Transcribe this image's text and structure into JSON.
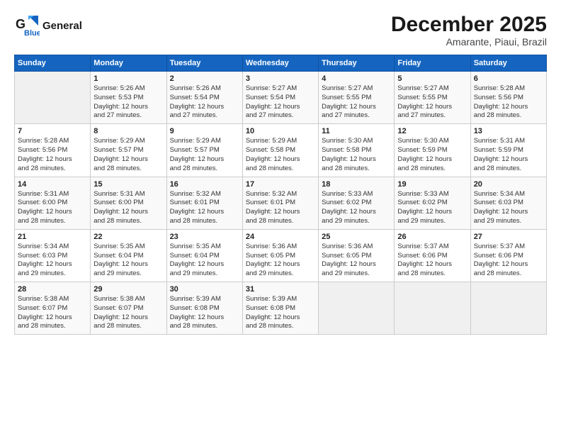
{
  "header": {
    "logo_line1": "General",
    "logo_line2": "Blue",
    "title": "December 2025",
    "subtitle": "Amarante, Piaui, Brazil"
  },
  "columns": [
    "Sunday",
    "Monday",
    "Tuesday",
    "Wednesday",
    "Thursday",
    "Friday",
    "Saturday"
  ],
  "weeks": [
    [
      {
        "day": "",
        "sunrise": "",
        "sunset": "",
        "daylight": ""
      },
      {
        "day": "1",
        "sunrise": "Sunrise: 5:26 AM",
        "sunset": "Sunset: 5:53 PM",
        "daylight": "Daylight: 12 hours and 27 minutes."
      },
      {
        "day": "2",
        "sunrise": "Sunrise: 5:26 AM",
        "sunset": "Sunset: 5:54 PM",
        "daylight": "Daylight: 12 hours and 27 minutes."
      },
      {
        "day": "3",
        "sunrise": "Sunrise: 5:27 AM",
        "sunset": "Sunset: 5:54 PM",
        "daylight": "Daylight: 12 hours and 27 minutes."
      },
      {
        "day": "4",
        "sunrise": "Sunrise: 5:27 AM",
        "sunset": "Sunset: 5:55 PM",
        "daylight": "Daylight: 12 hours and 27 minutes."
      },
      {
        "day": "5",
        "sunrise": "Sunrise: 5:27 AM",
        "sunset": "Sunset: 5:55 PM",
        "daylight": "Daylight: 12 hours and 27 minutes."
      },
      {
        "day": "6",
        "sunrise": "Sunrise: 5:28 AM",
        "sunset": "Sunset: 5:56 PM",
        "daylight": "Daylight: 12 hours and 28 minutes."
      }
    ],
    [
      {
        "day": "7",
        "sunrise": "Sunrise: 5:28 AM",
        "sunset": "Sunset: 5:56 PM",
        "daylight": "Daylight: 12 hours and 28 minutes."
      },
      {
        "day": "8",
        "sunrise": "Sunrise: 5:29 AM",
        "sunset": "Sunset: 5:57 PM",
        "daylight": "Daylight: 12 hours and 28 minutes."
      },
      {
        "day": "9",
        "sunrise": "Sunrise: 5:29 AM",
        "sunset": "Sunset: 5:57 PM",
        "daylight": "Daylight: 12 hours and 28 minutes."
      },
      {
        "day": "10",
        "sunrise": "Sunrise: 5:29 AM",
        "sunset": "Sunset: 5:58 PM",
        "daylight": "Daylight: 12 hours and 28 minutes."
      },
      {
        "day": "11",
        "sunrise": "Sunrise: 5:30 AM",
        "sunset": "Sunset: 5:58 PM",
        "daylight": "Daylight: 12 hours and 28 minutes."
      },
      {
        "day": "12",
        "sunrise": "Sunrise: 5:30 AM",
        "sunset": "Sunset: 5:59 PM",
        "daylight": "Daylight: 12 hours and 28 minutes."
      },
      {
        "day": "13",
        "sunrise": "Sunrise: 5:31 AM",
        "sunset": "Sunset: 5:59 PM",
        "daylight": "Daylight: 12 hours and 28 minutes."
      }
    ],
    [
      {
        "day": "14",
        "sunrise": "Sunrise: 5:31 AM",
        "sunset": "Sunset: 6:00 PM",
        "daylight": "Daylight: 12 hours and 28 minutes."
      },
      {
        "day": "15",
        "sunrise": "Sunrise: 5:31 AM",
        "sunset": "Sunset: 6:00 PM",
        "daylight": "Daylight: 12 hours and 28 minutes."
      },
      {
        "day": "16",
        "sunrise": "Sunrise: 5:32 AM",
        "sunset": "Sunset: 6:01 PM",
        "daylight": "Daylight: 12 hours and 28 minutes."
      },
      {
        "day": "17",
        "sunrise": "Sunrise: 5:32 AM",
        "sunset": "Sunset: 6:01 PM",
        "daylight": "Daylight: 12 hours and 28 minutes."
      },
      {
        "day": "18",
        "sunrise": "Sunrise: 5:33 AM",
        "sunset": "Sunset: 6:02 PM",
        "daylight": "Daylight: 12 hours and 29 minutes."
      },
      {
        "day": "19",
        "sunrise": "Sunrise: 5:33 AM",
        "sunset": "Sunset: 6:02 PM",
        "daylight": "Daylight: 12 hours and 29 minutes."
      },
      {
        "day": "20",
        "sunrise": "Sunrise: 5:34 AM",
        "sunset": "Sunset: 6:03 PM",
        "daylight": "Daylight: 12 hours and 29 minutes."
      }
    ],
    [
      {
        "day": "21",
        "sunrise": "Sunrise: 5:34 AM",
        "sunset": "Sunset: 6:03 PM",
        "daylight": "Daylight: 12 hours and 29 minutes."
      },
      {
        "day": "22",
        "sunrise": "Sunrise: 5:35 AM",
        "sunset": "Sunset: 6:04 PM",
        "daylight": "Daylight: 12 hours and 29 minutes."
      },
      {
        "day": "23",
        "sunrise": "Sunrise: 5:35 AM",
        "sunset": "Sunset: 6:04 PM",
        "daylight": "Daylight: 12 hours and 29 minutes."
      },
      {
        "day": "24",
        "sunrise": "Sunrise: 5:36 AM",
        "sunset": "Sunset: 6:05 PM",
        "daylight": "Daylight: 12 hours and 29 minutes."
      },
      {
        "day": "25",
        "sunrise": "Sunrise: 5:36 AM",
        "sunset": "Sunset: 6:05 PM",
        "daylight": "Daylight: 12 hours and 29 minutes."
      },
      {
        "day": "26",
        "sunrise": "Sunrise: 5:37 AM",
        "sunset": "Sunset: 6:06 PM",
        "daylight": "Daylight: 12 hours and 28 minutes."
      },
      {
        "day": "27",
        "sunrise": "Sunrise: 5:37 AM",
        "sunset": "Sunset: 6:06 PM",
        "daylight": "Daylight: 12 hours and 28 minutes."
      }
    ],
    [
      {
        "day": "28",
        "sunrise": "Sunrise: 5:38 AM",
        "sunset": "Sunset: 6:07 PM",
        "daylight": "Daylight: 12 hours and 28 minutes."
      },
      {
        "day": "29",
        "sunrise": "Sunrise: 5:38 AM",
        "sunset": "Sunset: 6:07 PM",
        "daylight": "Daylight: 12 hours and 28 minutes."
      },
      {
        "day": "30",
        "sunrise": "Sunrise: 5:39 AM",
        "sunset": "Sunset: 6:08 PM",
        "daylight": "Daylight: 12 hours and 28 minutes."
      },
      {
        "day": "31",
        "sunrise": "Sunrise: 5:39 AM",
        "sunset": "Sunset: 6:08 PM",
        "daylight": "Daylight: 12 hours and 28 minutes."
      },
      {
        "day": "",
        "sunrise": "",
        "sunset": "",
        "daylight": ""
      },
      {
        "day": "",
        "sunrise": "",
        "sunset": "",
        "daylight": ""
      },
      {
        "day": "",
        "sunrise": "",
        "sunset": "",
        "daylight": ""
      }
    ]
  ]
}
